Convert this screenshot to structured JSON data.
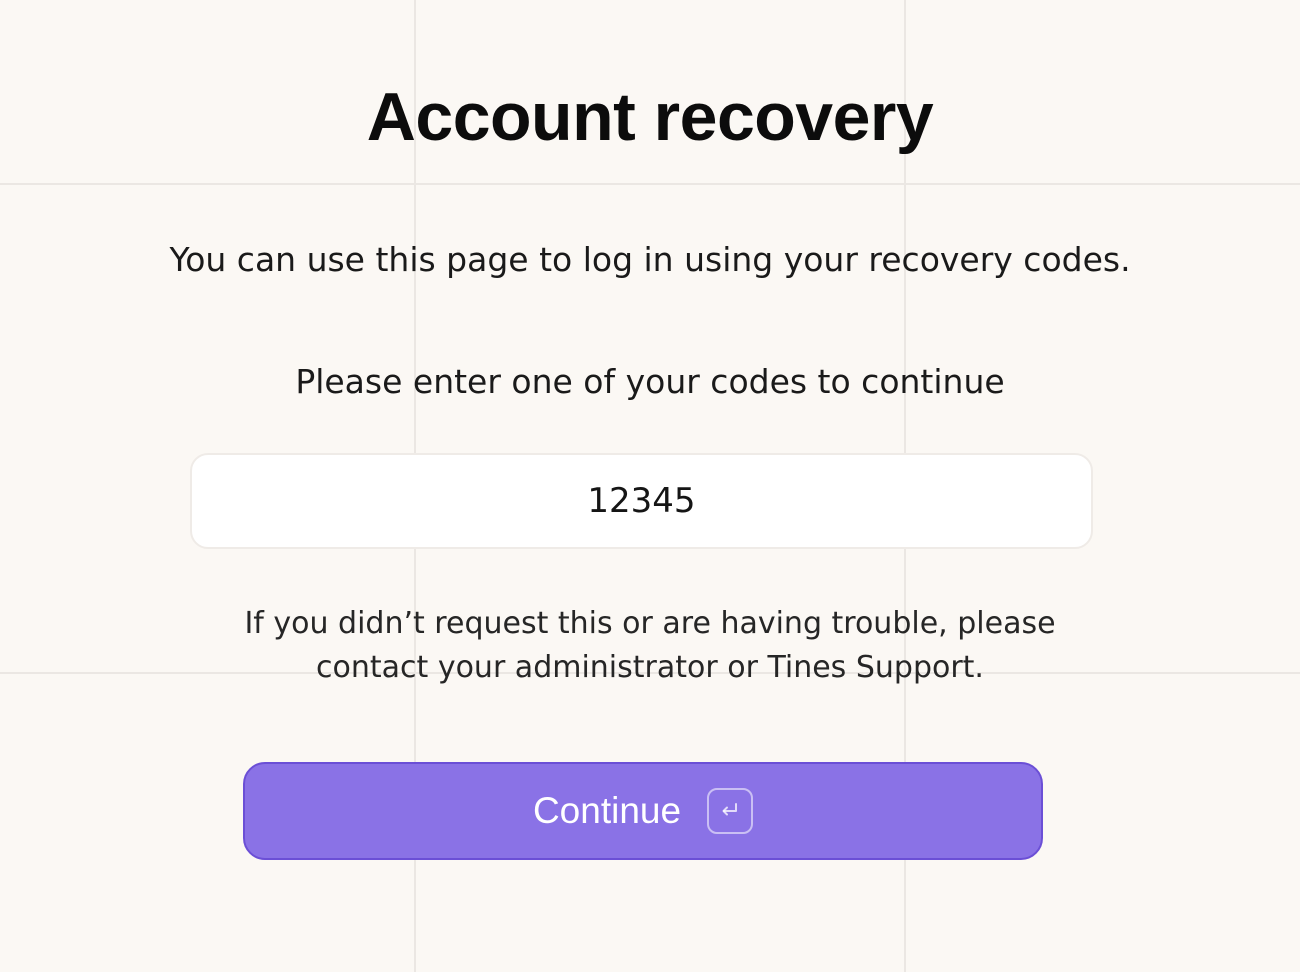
{
  "page": {
    "title": "Account recovery",
    "subtitle": "You can use this page to log in using your recovery codes.",
    "prompt": "Please enter one of your codes to continue"
  },
  "form": {
    "code_value": "12345",
    "continue_label": "Continue",
    "continue_key_icon": "enter-key-icon"
  },
  "help": {
    "line1": "If you didn’t request this or are having trouble, please",
    "line2": "contact your administrator or Tines Support."
  },
  "colors": {
    "background": "#fbf8f4",
    "button": "#8a72e6",
    "button_border": "#6b4fd6",
    "grid": "#ebe7e3"
  }
}
